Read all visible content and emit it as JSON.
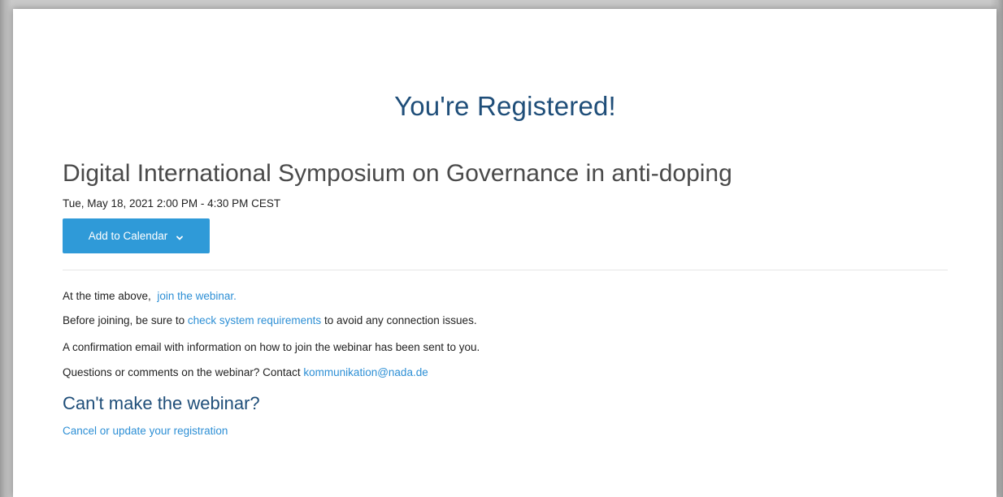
{
  "headline": "You're Registered!",
  "event": {
    "title": "Digital International Symposium on Governance in anti-doping",
    "date": "Tue, May 18, 2021 2:00 PM - 4:30 PM CEST"
  },
  "calendar_button": {
    "label": "Add to Calendar",
    "icon": "chevron-down-icon"
  },
  "info": {
    "line1_prefix": "At the time above,",
    "line1_link": "join the webinar.",
    "line2_prefix": "Before joining, be sure to",
    "line2_link": "check system requirements",
    "line2_suffix": "to avoid any connection issues.",
    "line3": "A confirmation email with information on how to join the webinar has been sent to you.",
    "line4_prefix": "Questions or comments on the webinar? Contact",
    "line4_link": "kommunikation@nada.de"
  },
  "cant_make_it": {
    "heading": "Can't make the webinar?",
    "link": "Cancel or update your registration"
  },
  "colors": {
    "accent_blue": "#2f9ad8",
    "link_blue": "#2d8fd5",
    "heading_navy": "#1f4e79"
  }
}
